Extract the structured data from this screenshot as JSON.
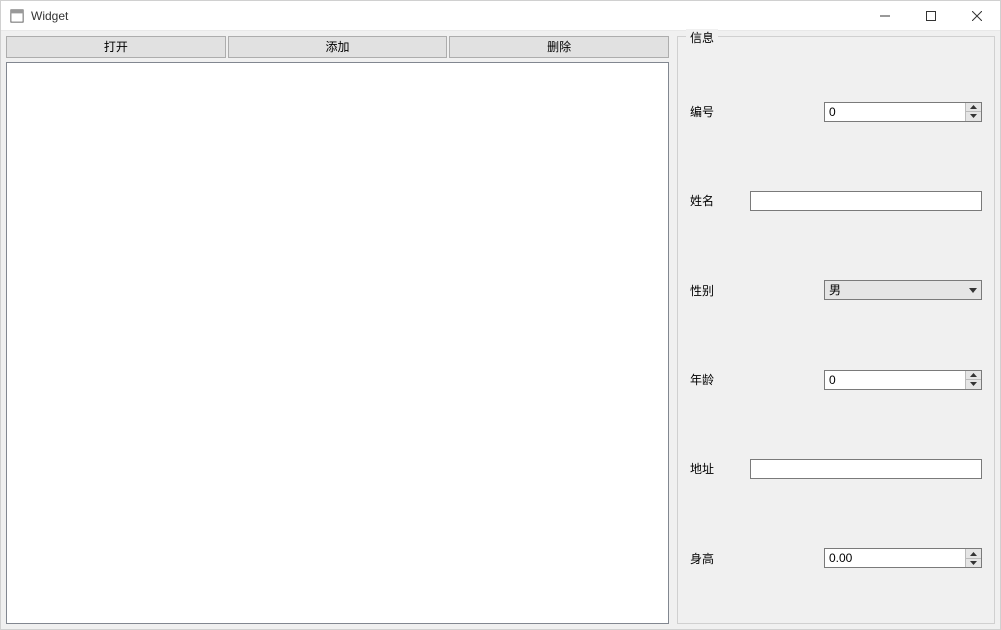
{
  "window": {
    "title": "Widget"
  },
  "toolbar": {
    "open_label": "打开",
    "add_label": "添加",
    "delete_label": "删除"
  },
  "groupbox": {
    "title": "信息"
  },
  "form": {
    "id_label": "编号",
    "id_value": "0",
    "name_label": "姓名",
    "name_value": "",
    "gender_label": "性别",
    "gender_value": "男",
    "age_label": "年龄",
    "age_value": "0",
    "address_label": "地址",
    "address_value": "",
    "height_label": "身高",
    "height_value": "0.00"
  }
}
